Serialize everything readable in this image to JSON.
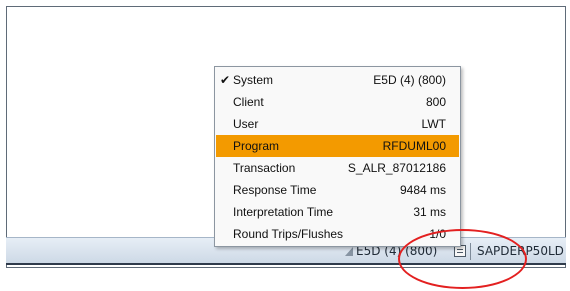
{
  "menu": {
    "items": [
      {
        "label": "System",
        "value": "E5D (4) (800)",
        "checked": true
      },
      {
        "label": "Client",
        "value": "800"
      },
      {
        "label": "User",
        "value": "LWT"
      },
      {
        "label": "Program",
        "value": "RFDUML00",
        "active": true
      },
      {
        "label": "Transaction",
        "value": "S_ALR_87012186"
      },
      {
        "label": "Response Time",
        "value": "9484 ms"
      },
      {
        "label": "Interpretation Time",
        "value": "31 ms"
      },
      {
        "label": "Round Trips/Flushes",
        "value": "1/0"
      }
    ],
    "checkmark": "✔",
    "highlight_color": "#f39a00"
  },
  "statusbar": {
    "system": "E5D (4) (800)",
    "server": "SAPDERP50LD"
  },
  "annotation": {
    "color": "#e32020"
  }
}
